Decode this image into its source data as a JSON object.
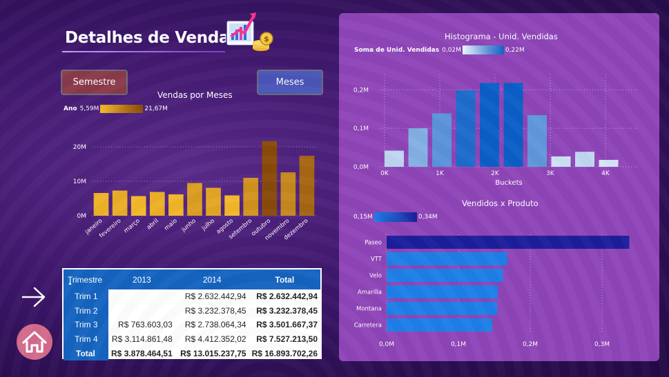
{
  "header": {
    "title": "Detalhes de Vendas"
  },
  "buttons": {
    "semestre": "Semestre",
    "meses": "Meses"
  },
  "chart_data": [
    {
      "type": "bar",
      "title": "Vendas por Meses",
      "legend": {
        "label": "Ano",
        "min_label": "5,59M",
        "max_label": "21,67M"
      },
      "categories": [
        "janeiro",
        "fevereiro",
        "março",
        "abril",
        "maio",
        "junho",
        "julho",
        "agosto",
        "setembro",
        "outubro",
        "novembro",
        "dezembro"
      ],
      "values": [
        6.6,
        7.3,
        5.7,
        6.9,
        6.2,
        9.5,
        8.1,
        5.9,
        11.0,
        21.67,
        12.6,
        17.4
      ],
      "yticks": [
        "0M",
        "10M",
        "20M"
      ],
      "ylim": [
        0,
        24
      ],
      "colors": {
        "low": "#f4b82a",
        "high": "#8a4a0a"
      }
    },
    {
      "type": "bar",
      "title": "Histograma - Unid. Vendidas",
      "legend": {
        "label": "Soma de Unid. Vendidas",
        "min_label": "0,02M",
        "max_label": "0,22M"
      },
      "x": [
        100,
        600,
        1100,
        1600,
        2100,
        2600,
        3100,
        3600,
        4100
      ],
      "values": [
        0.042,
        0.1,
        0.139,
        0.199,
        0.218,
        0.218,
        0.134,
        0.027,
        0.039,
        0.018
      ],
      "xticks": [
        "0K",
        "1K",
        "2K",
        "3K",
        "4K"
      ],
      "yticks": [
        "0,0M",
        "0,1M",
        "0,2M"
      ],
      "xlabel": "Buckets",
      "ylim": [
        0,
        0.24
      ],
      "colors": {
        "low": "#d6e6f7",
        "high": "#0b5fc7"
      }
    },
    {
      "type": "bar",
      "orientation": "horizontal",
      "title": "Vendidos x Produto",
      "legend": {
        "min_label": "0,15M",
        "max_label": "0,34M"
      },
      "categories": [
        "Paseo",
        "VTT",
        "Velo",
        "Amarilla",
        "Montana",
        "Carretera"
      ],
      "values": [
        0.338,
        0.168,
        0.162,
        0.155,
        0.154,
        0.147
      ],
      "xticks": [
        "0,0M",
        "0,1M",
        "0,2M",
        "0,3M"
      ],
      "xlim": [
        0,
        0.35
      ],
      "colors": {
        "top": "#1c1f9c",
        "rest": "#1e7fe8"
      }
    }
  ],
  "matrix": {
    "row_header": "Trimestre",
    "columns": [
      "2013",
      "2014",
      "Total"
    ],
    "rows": [
      {
        "label": "Trim 1",
        "cells": [
          "",
          "R$ 2.632.442,94",
          "R$ 2.632.442,94"
        ]
      },
      {
        "label": "Trim 2",
        "cells": [
          "",
          "R$ 3.232.378,45",
          "R$ 3.232.378,45"
        ]
      },
      {
        "label": "Trim 3",
        "cells": [
          "R$ 763.603,03",
          "R$ 2.738.064,34",
          "R$ 3.501.667,37"
        ]
      },
      {
        "label": "Trim 4",
        "cells": [
          "R$ 3.114.861,48",
          "R$ 4.412.352,02",
          "R$ 7.527.213,50"
        ]
      }
    ],
    "total": {
      "label": "Total",
      "cells": [
        "R$ 3.878.464,51",
        "R$ 13.015.237,75",
        "R$ 16.893.702,26"
      ]
    }
  },
  "icons": {
    "arrow": "arrow-right-icon",
    "home": "home-icon",
    "logo": "sales-growth-icon"
  }
}
